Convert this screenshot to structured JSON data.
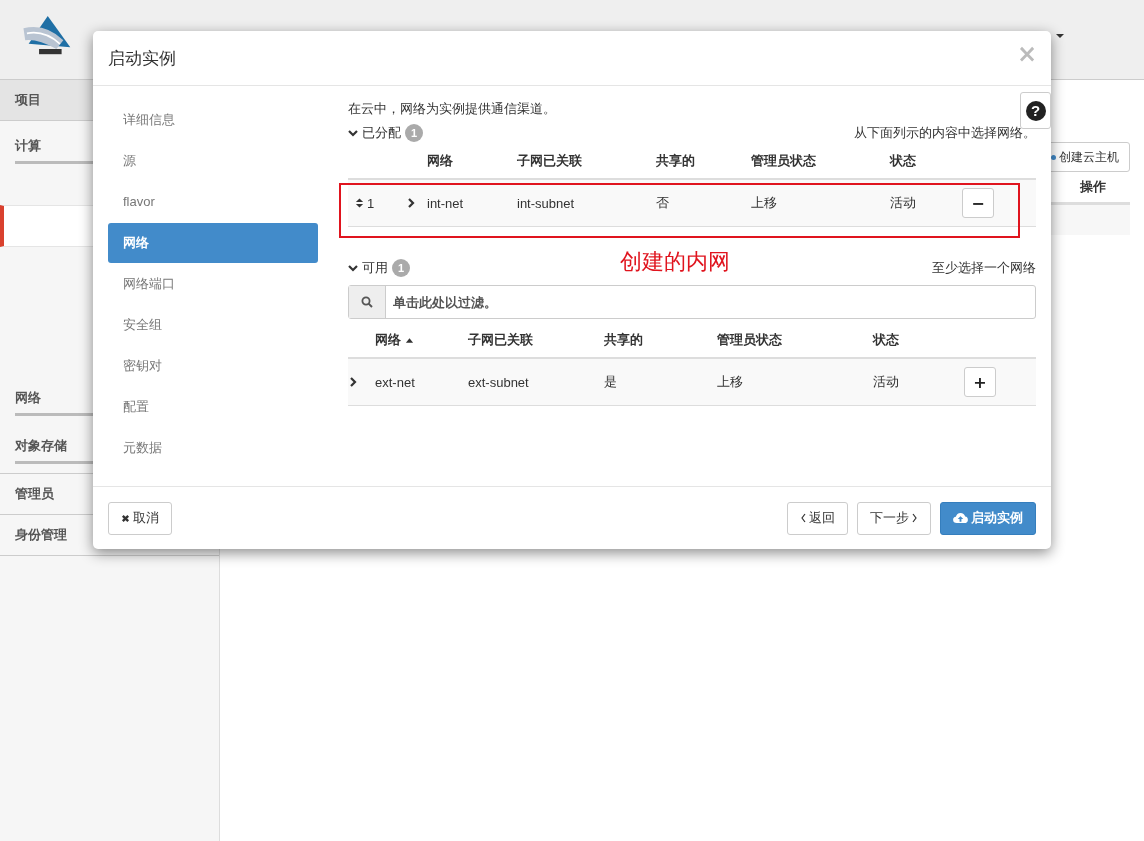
{
  "page": {
    "sidebar": [
      {
        "kind": "header",
        "label": "项目"
      },
      {
        "kind": "group",
        "label": "计算"
      },
      {
        "kind": "active",
        "selected": true
      },
      {
        "kind": "group",
        "label": "网络"
      },
      {
        "kind": "group",
        "label": "对象存储"
      },
      {
        "kind": "plain",
        "label": "管理员"
      },
      {
        "kind": "plain",
        "label": "身份管理"
      }
    ],
    "create_button": "创建云主机",
    "actions_header": "操作"
  },
  "modal": {
    "title": "启动实例",
    "close": "×",
    "steps": [
      {
        "label": "详细信息",
        "selected": false
      },
      {
        "label": "源",
        "selected": false
      },
      {
        "label": "flavor",
        "selected": false
      },
      {
        "label": "网络",
        "selected": true
      },
      {
        "label": "网络端口",
        "selected": false
      },
      {
        "label": "安全组",
        "selected": false
      },
      {
        "label": "密钥对",
        "selected": false
      },
      {
        "label": "配置",
        "selected": false
      },
      {
        "label": "元数据",
        "selected": false
      }
    ],
    "help": "?",
    "description": "在云中，网络为实例提供通信渠道。",
    "allocated": {
      "label": "已分配",
      "count": "1",
      "hint": "从下面列示的内容中选择网络。",
      "columns": [
        "网络",
        "子网已关联",
        "共享的",
        "管理员状态",
        "状态"
      ],
      "rows": [
        {
          "order": "1",
          "network": "int-net",
          "subnet": "int-subnet",
          "shared": "否",
          "admin_state": "上移",
          "status": "活动",
          "action": "−"
        }
      ]
    },
    "available": {
      "label": "可用",
      "count": "1",
      "hint": "至少选择一个网络",
      "filter_placeholder": "单击此处以过滤。",
      "columns": [
        {
          "label": "网络",
          "sorted": true
        },
        {
          "label": "子网已关联",
          "sorted": false
        },
        {
          "label": "共享的",
          "sorted": false
        },
        {
          "label": "管理员状态",
          "sorted": false
        },
        {
          "label": "状态",
          "sorted": false
        }
      ],
      "rows": [
        {
          "network": "ext-net",
          "subnet": "ext-subnet",
          "shared": "是",
          "admin_state": "上移",
          "status": "活动",
          "action": "+"
        }
      ]
    },
    "footer": {
      "cancel": "取消",
      "back": "返回",
      "next": "下一步",
      "launch": "启动实例"
    }
  },
  "annotation": {
    "text": "创建的内网"
  }
}
